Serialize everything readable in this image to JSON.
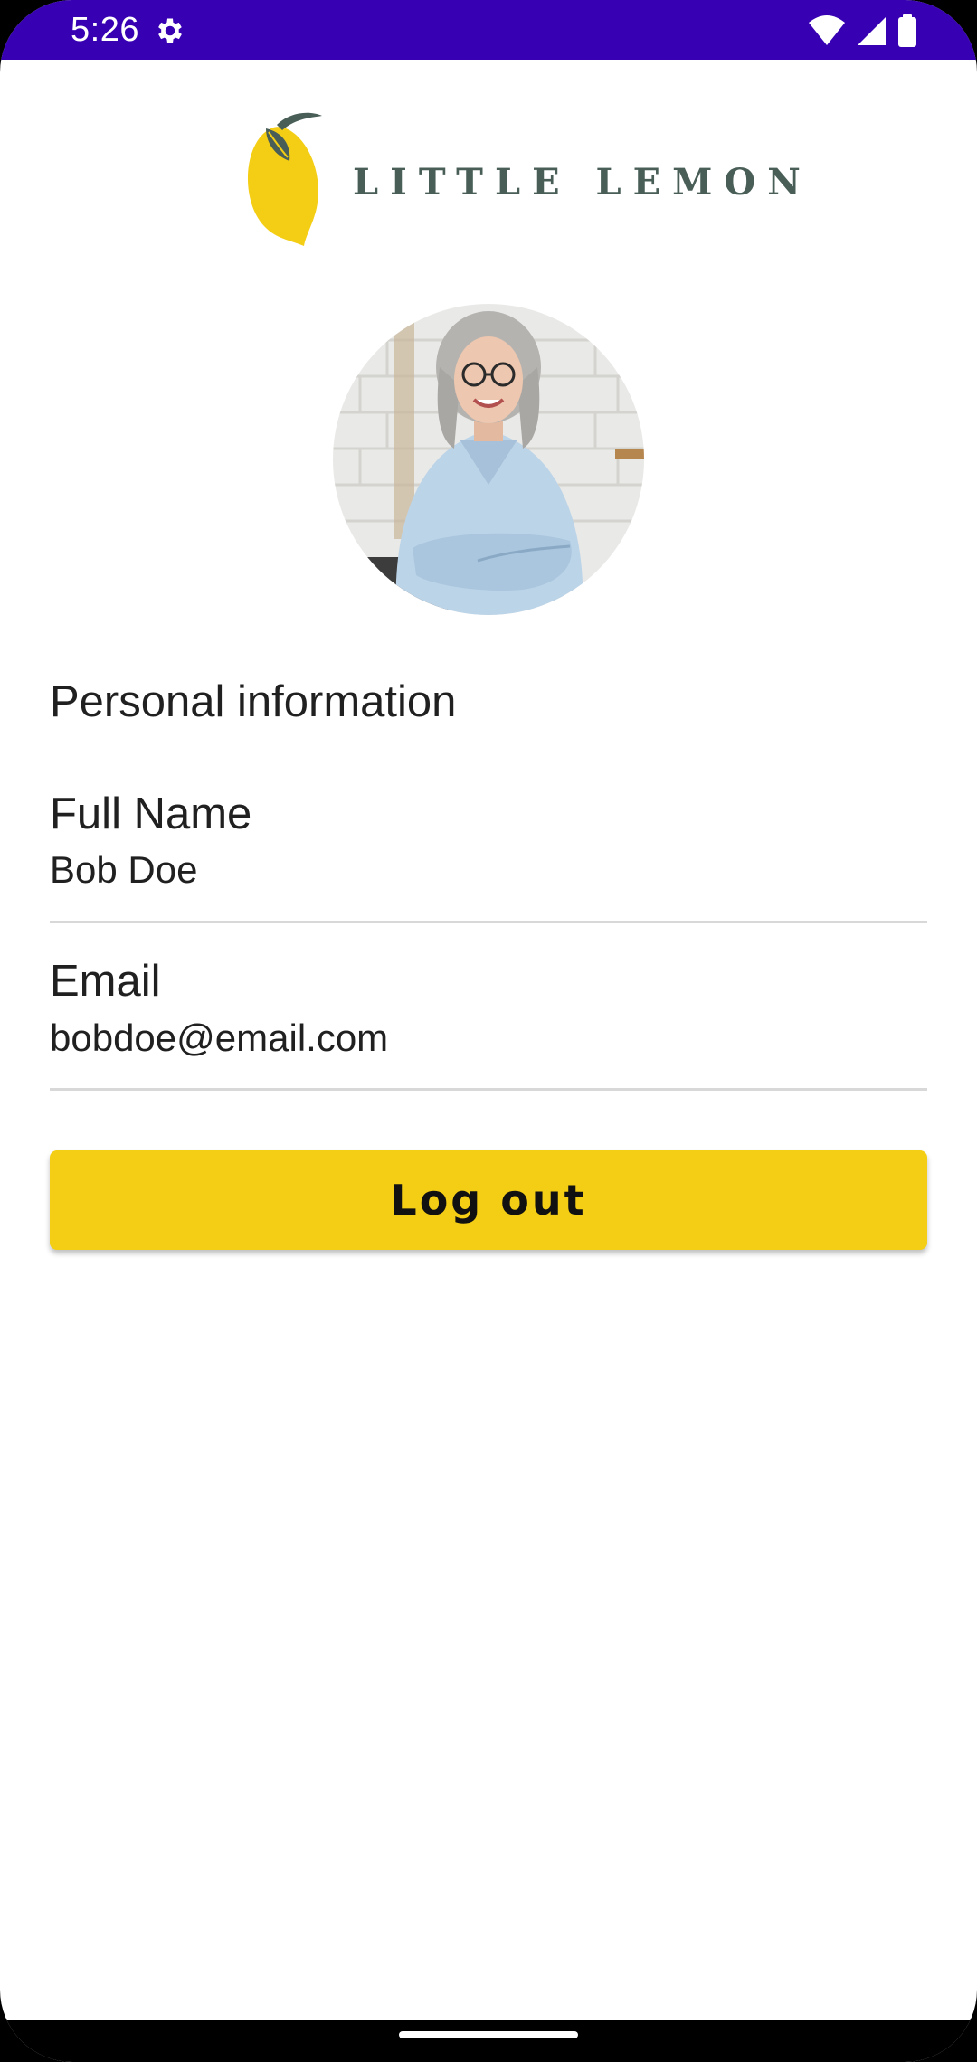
{
  "status_bar": {
    "time": "5:26",
    "background": "#3700b3",
    "icons": [
      "settings-gear-icon",
      "wifi-icon",
      "cell-signal-icon",
      "battery-icon"
    ]
  },
  "header": {
    "logo_text": "LITTLE LEMON",
    "logo_colors": {
      "lemon": "#f4ce14",
      "leaf": "#495e57"
    }
  },
  "profile": {
    "section_title": "Personal information",
    "full_name_label": "Full Name",
    "full_name_value": "Bob Doe",
    "email_label": "Email",
    "email_value": "bobdoe@email.com"
  },
  "actions": {
    "logout_label": "Log out",
    "logout_color": "#f4ce14"
  }
}
